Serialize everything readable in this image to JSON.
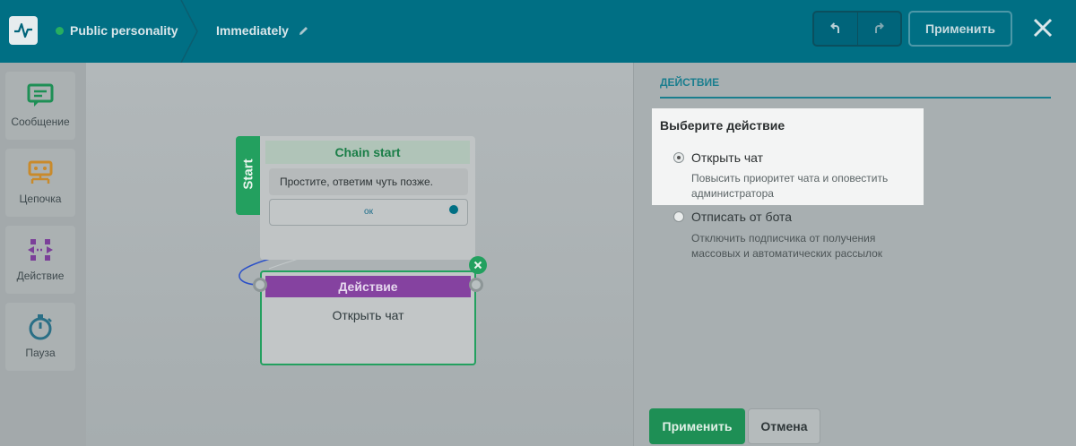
{
  "header": {
    "status_color": "#27ae60",
    "bot_name": "Public personality",
    "flow_name": "Immediately",
    "apply_label": "Применить",
    "icons": [
      "pulse-logo-icon",
      "pencil-icon",
      "undo-icon",
      "redo-icon",
      "close-icon"
    ]
  },
  "toolbox": {
    "items": [
      {
        "label": "Сообщение",
        "icon": "message-icon",
        "color": "#1e8f55"
      },
      {
        "label": "Цепочка",
        "icon": "chain-icon",
        "color": "#c98a2b"
      },
      {
        "label": "Действие",
        "icon": "action-icon",
        "color": "#7b3f99"
      },
      {
        "label": "Пауза",
        "icon": "stopwatch-icon",
        "color": "#2a6f86"
      }
    ]
  },
  "canvas": {
    "start_label": "Start",
    "chain_node": {
      "title": "Chain start",
      "message": "Простите, ответим чуть позже.",
      "button_label": "ок"
    },
    "action_node": {
      "title": "Действие",
      "text": "Открыть чат"
    }
  },
  "panel": {
    "section_title": "ДЕЙСТВИЕ",
    "question": "Выберите действие",
    "options": [
      {
        "label": "Открыть чат",
        "description": "Повысить приоритет чата и оповестить администратора",
        "selected": true
      },
      {
        "label": "Отписать от бота",
        "description": "Отключить подписчика от получения массовых и автоматических рассылок",
        "selected": false
      }
    ],
    "apply_label": "Применить",
    "cancel_label": "Отмена"
  }
}
